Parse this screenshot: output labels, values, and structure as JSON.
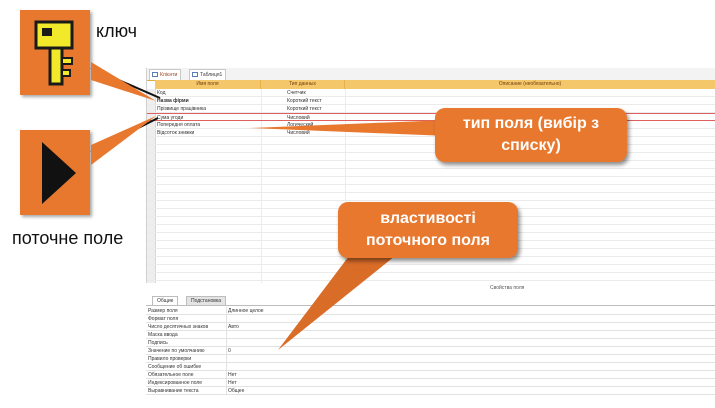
{
  "labels": {
    "key": "ключ",
    "current_field": "поточне поле"
  },
  "callouts": {
    "field_type": "тип поля (вибір з списку)",
    "properties": "властивості поточного поля"
  },
  "table_window": {
    "tabs": [
      "Клієнти",
      "Таблиця1"
    ],
    "columns": [
      "Имя поля",
      "Тип данных",
      "Описание (необязательно)"
    ],
    "rows": [
      {
        "name": "Код",
        "type": "Счетчик"
      },
      {
        "name": "Назва фірми",
        "type": "Короткий текст"
      },
      {
        "name": "Прізвище працівника",
        "type": "Короткий текст"
      },
      {
        "name": "Сума угоди",
        "type": "Числовий"
      },
      {
        "name": "Попередня оплата",
        "type": "Логический"
      },
      {
        "name": "Відсоток знижки",
        "type": "Числовий"
      }
    ],
    "properties_caption": "Свойства поля"
  },
  "properties_pane": {
    "tabs": [
      "Общие",
      "Подстановка"
    ],
    "rows": [
      {
        "k": "Размер поля",
        "v": "Длинное целое"
      },
      {
        "k": "Формат поля",
        "v": ""
      },
      {
        "k": "Число десятичных знаков",
        "v": "Авто"
      },
      {
        "k": "Маска ввода",
        "v": ""
      },
      {
        "k": "Подпись",
        "v": ""
      },
      {
        "k": "Значение по умолчанию",
        "v": "0"
      },
      {
        "k": "Правило проверки",
        "v": ""
      },
      {
        "k": "Сообщение об ошибке",
        "v": ""
      },
      {
        "k": "Обязательное поле",
        "v": "Нет"
      },
      {
        "k": "Индексированное поле",
        "v": "Нет"
      },
      {
        "k": "Выравнивание текста",
        "v": "Общее"
      }
    ]
  },
  "colors": {
    "accent_orange": "#e8782e",
    "header_gold": "#f4c76a",
    "callout_text": "#ffffff"
  }
}
